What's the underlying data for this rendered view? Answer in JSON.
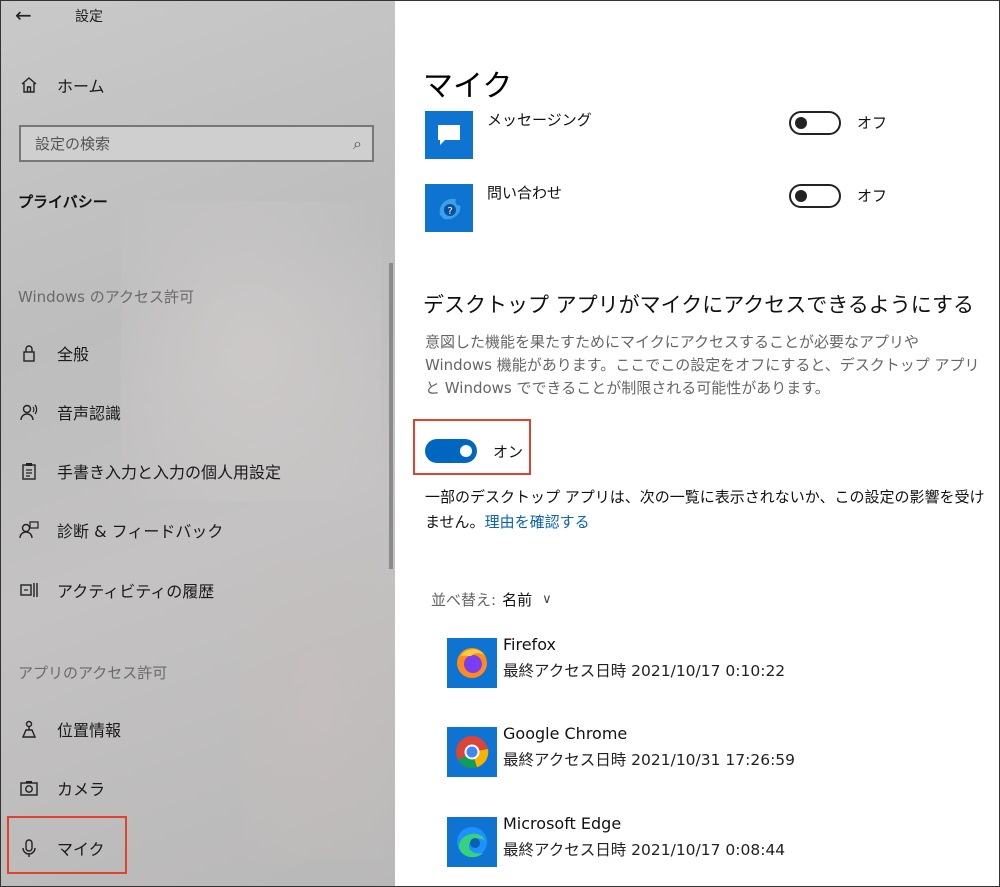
{
  "window": {
    "title": "設定"
  },
  "sidebar": {
    "home_label": "ホーム",
    "search_placeholder": "設定の検索",
    "heading": "プライバシー",
    "section_windows": "Windows のアクセス許可",
    "windows_items": [
      {
        "label": "全般",
        "icon": "lock-icon"
      },
      {
        "label": "音声認識",
        "icon": "speech-icon"
      },
      {
        "label": "手書き入力と入力の個人用設定",
        "icon": "clipboard-icon"
      },
      {
        "label": "診断 & フィードバック",
        "icon": "feedback-icon"
      },
      {
        "label": "アクティビティの履歴",
        "icon": "timeline-icon"
      }
    ],
    "section_apps": "アプリのアクセス許可",
    "app_items": [
      {
        "label": "位置情報",
        "icon": "location-icon"
      },
      {
        "label": "カメラ",
        "icon": "camera-icon"
      },
      {
        "label": "マイク",
        "icon": "microphone-icon",
        "selected": true
      }
    ]
  },
  "main": {
    "title": "マイク",
    "apps_top": [
      {
        "name": "メッセージング",
        "toggle_label": "オフ",
        "state": "off",
        "icon": "message-icon"
      },
      {
        "name": "問い合わせ",
        "toggle_label": "オフ",
        "state": "off",
        "icon": "help-icon"
      }
    ],
    "desktop_section": {
      "heading": "デスクトップ アプリがマイクにアクセスできるようにする",
      "description": "意図した機能を果たすためにマイクにアクセスすることが必要なアプリや Windows 機能があります。ここでこの設定をオフにすると、デスクトップ アプリと Windows でできることが制限される可能性があります。",
      "toggle_label": "オン",
      "toggle_state": "on",
      "note_text": "一部のデスクトップ アプリは、次の一覧に表示されないか、この設定の影響を受けません。",
      "note_link": "理由を確認する"
    },
    "sort": {
      "label": "並べ替え:",
      "value": "名前"
    },
    "desktop_apps": [
      {
        "name": "Firefox",
        "last_access": "最終アクセス日時 2021/10/17 0:10:22",
        "icon": "firefox-icon"
      },
      {
        "name": "Google Chrome",
        "last_access": "最終アクセス日時 2021/10/31 17:26:59",
        "icon": "chrome-icon"
      },
      {
        "name": "Microsoft Edge",
        "last_access": "最終アクセス日時 2021/10/17 0:08:44",
        "icon": "edge-icon"
      }
    ]
  },
  "colors": {
    "accent": "#0067c0",
    "highlight": "#e0432d",
    "tile": "#0f74d1"
  }
}
